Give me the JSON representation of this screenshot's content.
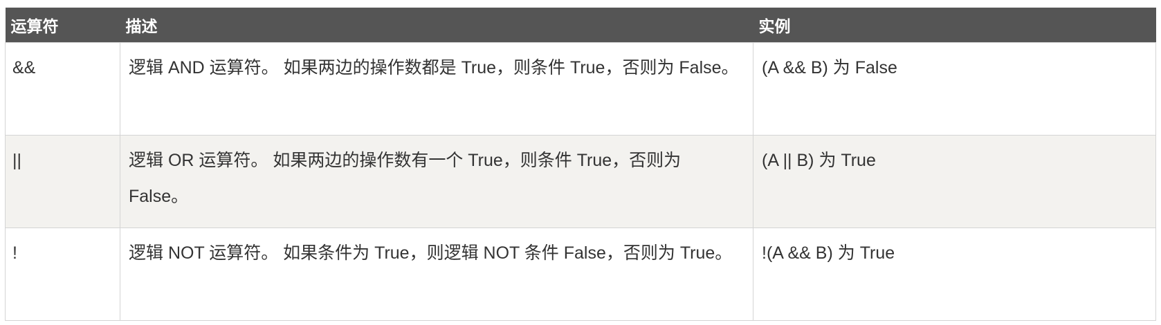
{
  "table": {
    "headers": [
      "运算符",
      "描述",
      "实例"
    ],
    "rows": [
      {
        "operator": "&&",
        "description": "逻辑 AND 运算符。 如果两边的操作数都是 True，则条件 True，否则为 False。",
        "example": "(A && B) 为 False"
      },
      {
        "operator": "||",
        "description": "逻辑 OR 运算符。 如果两边的操作数有一个 True，则条件 True，否则为 False。",
        "example": "(A || B) 为 True"
      },
      {
        "operator": "!",
        "description": "逻辑 NOT 运算符。 如果条件为 True，则逻辑 NOT 条件 False，否则为 True。",
        "example": "!(A && B) 为 True"
      }
    ]
  },
  "colors": {
    "header_background": "#555555",
    "header_text": "#ffffff",
    "alt_row_background": "#f3f2ef",
    "border": "#d4d4d4"
  }
}
